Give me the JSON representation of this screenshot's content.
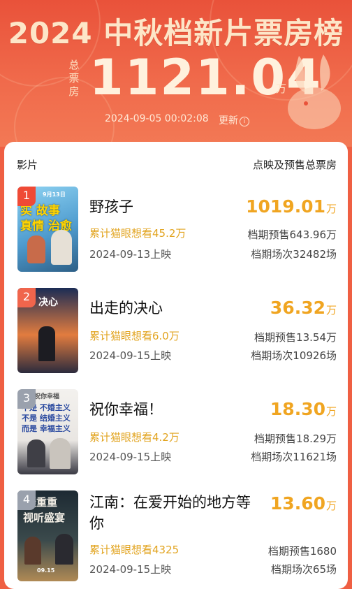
{
  "header": {
    "title": "2024 中秋档新片票房榜",
    "total_label": "总票房",
    "total_value": "1121.04",
    "total_unit": "万",
    "timestamp": "2024-09-05  00:02:08",
    "refresh_label": "更新"
  },
  "columns": {
    "film": "影片",
    "box_office": "点映及预售总票房"
  },
  "movies": [
    {
      "rank": "1",
      "title": "野孩子",
      "want": "累计猫眼想看45.2万",
      "release": "2024-09-13上映",
      "box": "1019.01",
      "box_unit": "万",
      "presale": "档期预售643.96万",
      "shows": "档期场次32482场",
      "poster_text": [
        "9月13日",
        "实 故事",
        "真情 治愈"
      ]
    },
    {
      "rank": "2",
      "title": "出走的决心",
      "want": "累计猫眼想看6.0万",
      "release": "2024-09-15上映",
      "box": "36.32",
      "box_unit": "万",
      "presale": "档期预售13.54万",
      "shows": "档期场次10926场",
      "poster_text": [
        "决心"
      ]
    },
    {
      "rank": "3",
      "title": "祝你幸福！",
      "want": "累计猫眼想看4.2万",
      "release": "2024-09-15上映",
      "box": "18.30",
      "box_unit": "万",
      "presale": "档期预售18.29万",
      "shows": "档期场次11621场",
      "poster_text": [
        "祝你幸福",
        "不是 不婚主义",
        "不是 结婚主义",
        "而是 幸福主义"
      ]
    },
    {
      "rank": "4",
      "title": "江南：在爱开始的地方等你",
      "want": "累计猫眼想看4325",
      "release": "2024-09-15上映",
      "box": "13.60",
      "box_unit": "万",
      "presale": "档期预售1680",
      "shows": "档期场次65场",
      "poster_text": [
        "疑重重",
        "视听盛宴",
        "09.15"
      ]
    }
  ],
  "colors": {
    "header_bg": "#e9523a",
    "accent_gold": "#f0a521",
    "rank_red": "#ef4a36"
  }
}
